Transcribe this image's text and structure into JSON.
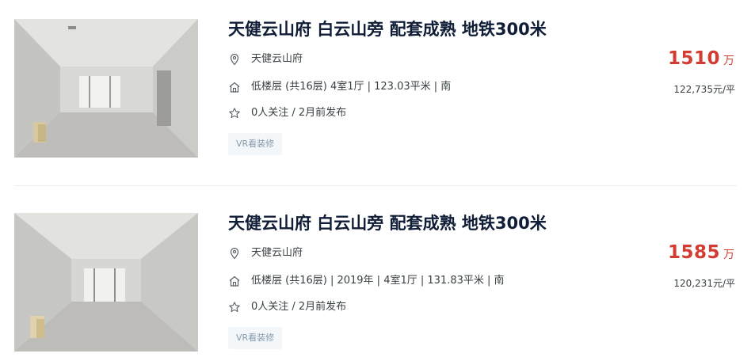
{
  "listings": [
    {
      "title": "天健云山府 白云山旁 配套成熟 地铁300米",
      "community": "天健云山府",
      "house_info": "低楼层 (共16层) 4室1厅 | 123.03平米 | 南",
      "follow_info": "0人关注 / 2月前发布",
      "tag": "VR看装修",
      "total_price": "1510",
      "total_price_unit": "万",
      "unit_price": "122,735元/平",
      "icons": {
        "location": "location-pin-icon",
        "house": "house-icon",
        "follow": "star-icon"
      }
    },
    {
      "title": "天健云山府 白云山旁 配套成熟 地铁300米",
      "community": "天健云山府",
      "house_info": "低楼层 (共16层) | 2019年 | 4室1厅 | 131.83平米 | 南",
      "follow_info": "0人关注 / 2月前发布",
      "tag": "VR看装修",
      "total_price": "1585",
      "total_price_unit": "万",
      "unit_price": "120,231元/平",
      "icons": {
        "location": "location-pin-icon",
        "house": "house-icon",
        "follow": "star-icon"
      }
    }
  ],
  "colors": {
    "title": "#101d37",
    "price": "#d33c30",
    "text": "#394043",
    "tag_text": "#849aae",
    "tag_bg": "#f4f7f9"
  }
}
